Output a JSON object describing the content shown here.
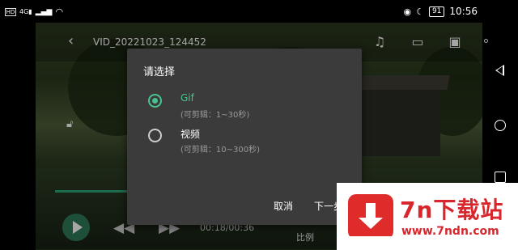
{
  "status_bar": {
    "left_icons": [
      "hd-icon",
      "signal-4g-icon",
      "signal-icon",
      "wifi-icon"
    ],
    "right_icons": [
      "eye-icon",
      "moon-icon"
    ],
    "battery": "91",
    "time": "10:56"
  },
  "player": {
    "title": "VID_20221023_124452",
    "time_readout": "00:18/00:36",
    "ratio_label": "比例",
    "progress": 0.17,
    "top_icons": [
      "music-note-icon",
      "subtitle-icon",
      "tv-cast-icon"
    ]
  },
  "dialog": {
    "title": "请选择",
    "options": [
      {
        "label": "Gif",
        "hint": "(可剪辑：1~30秒)",
        "checked": true
      },
      {
        "label": "视频",
        "hint": "(可剪辑：10~300秒)",
        "checked": false
      }
    ],
    "cancel_label": "取消",
    "next_label": "下一步"
  },
  "watermark": {
    "brand": "7n下载站",
    "url": "www.7ndn.com"
  },
  "colors": {
    "accent": "#49c28f",
    "dialog_bg": "#3b3b3b",
    "watermark_red": "#d8262d"
  }
}
